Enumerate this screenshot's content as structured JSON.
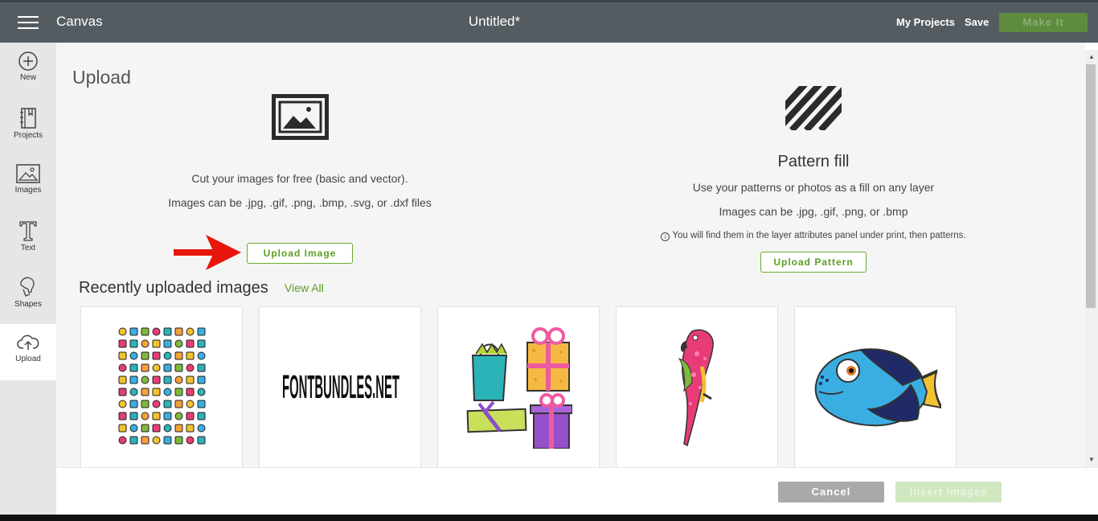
{
  "header": {
    "app_title": "Canvas",
    "doc_title": "Untitled*",
    "my_projects": "My Projects",
    "save": "Save",
    "make_it": "Make It"
  },
  "sidebar": {
    "items": [
      {
        "label": "New",
        "icon": "plus-circle-icon"
      },
      {
        "label": "Projects",
        "icon": "book-icon"
      },
      {
        "label": "Images",
        "icon": "image-icon"
      },
      {
        "label": "Text",
        "icon": "text-icon"
      },
      {
        "label": "Shapes",
        "icon": "shapes-icon"
      },
      {
        "label": "Upload",
        "icon": "cloud-upload-icon",
        "active": true
      }
    ]
  },
  "upload": {
    "heading": "Upload",
    "image_desc1": "Cut your images for free (basic and vector).",
    "image_desc2": "Images can be .jpg, .gif, .png, .bmp, .svg, or .dxf files",
    "upload_image_btn": "Upload Image",
    "pattern_title": "Pattern fill",
    "pattern_desc1": "Use your patterns or photos as a fill on any layer",
    "pattern_desc2": "Images can be .jpg, .gif, .png, or .bmp",
    "pattern_info": "You will find them in the layer attributes panel under print, then patterns.",
    "upload_pattern_btn": "Upload Pattern"
  },
  "recent": {
    "heading": "Recently uploaded images",
    "view_all": "View All",
    "items": [
      {
        "name": "icon-set"
      },
      {
        "name": "fontbundles-logo",
        "text": "FONTBUNDLES.NET"
      },
      {
        "name": "gift-bags"
      },
      {
        "name": "parrot"
      },
      {
        "name": "blue-fish"
      }
    ]
  },
  "footer": {
    "cancel": "Cancel",
    "insert": "Insert Images"
  },
  "colors": {
    "accent": "#6aab2e",
    "topbar": "#545c61",
    "arrow": "#e8160c"
  }
}
